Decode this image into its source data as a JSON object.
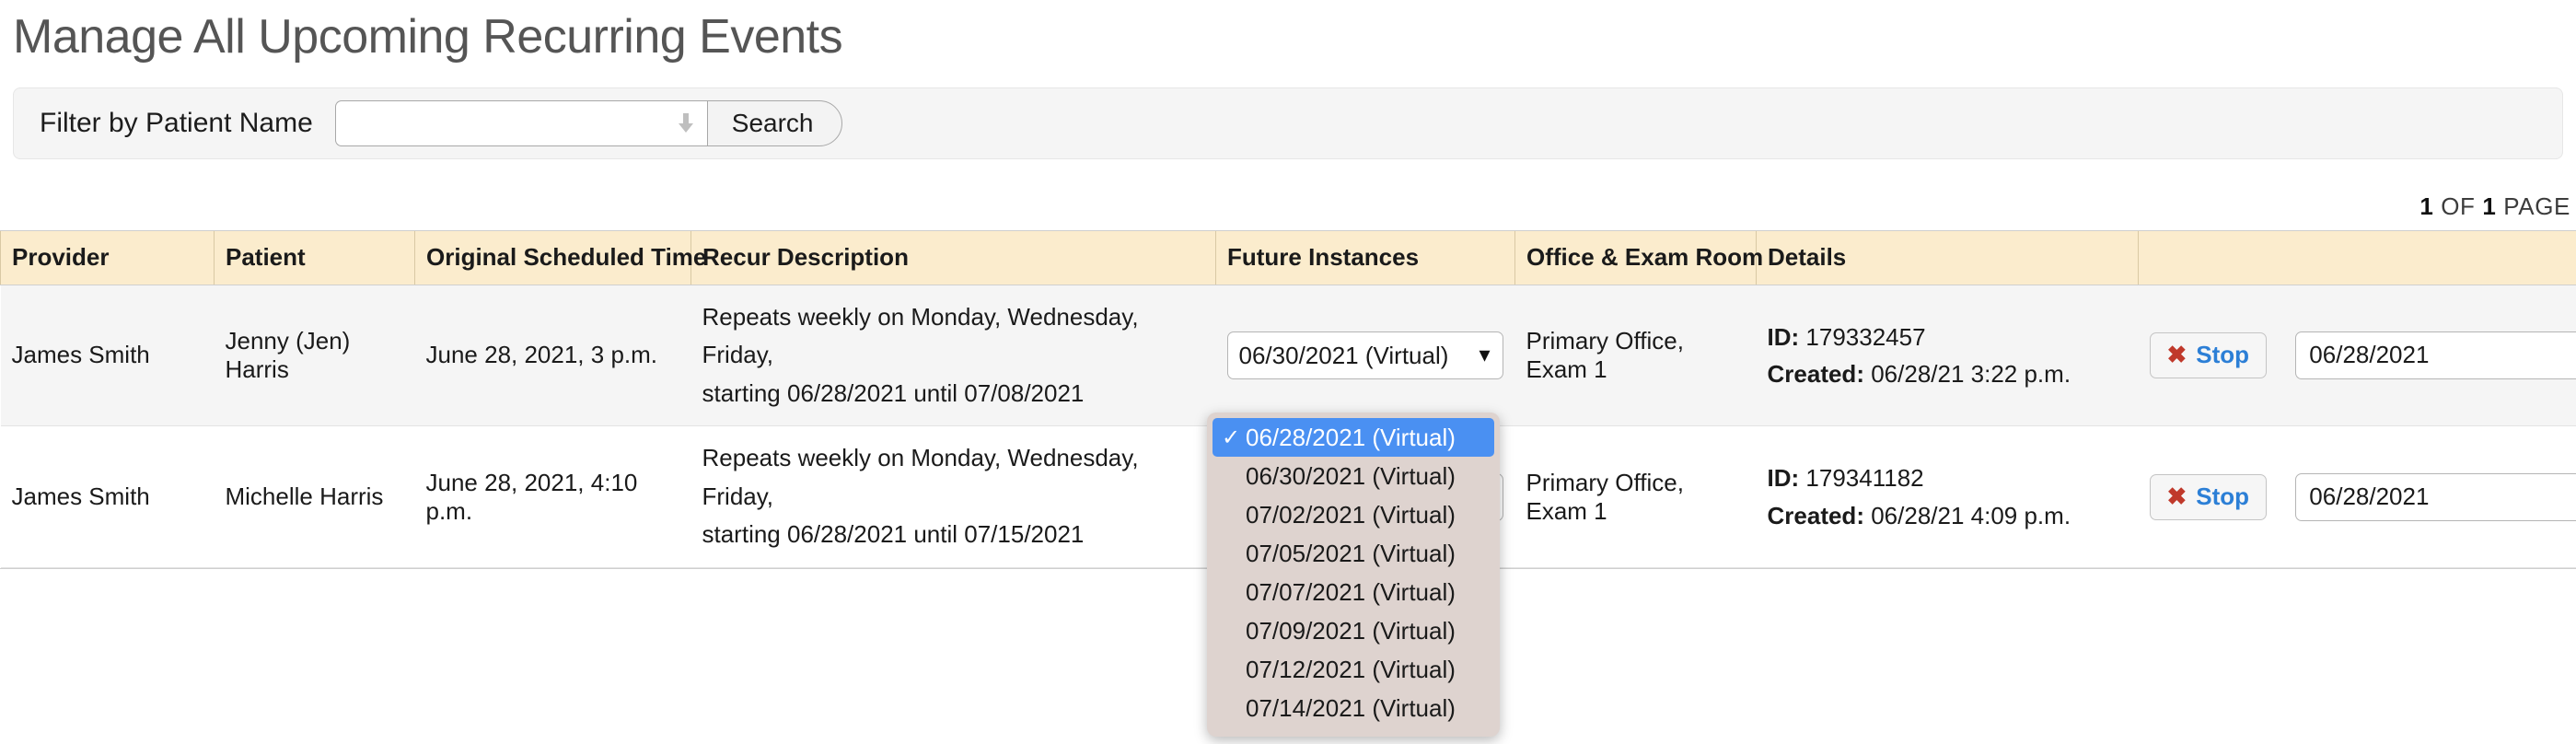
{
  "page_title": "Manage All Upcoming Recurring Events",
  "filter": {
    "label": "Filter by Patient Name",
    "input_value": "",
    "input_placeholder": "",
    "search_label": "Search",
    "combo_arrow_icon": "arrow-down-icon"
  },
  "pagination": {
    "current_page": "1",
    "of_text": "OF",
    "total_pages": "1",
    "pages_word": "PAGE"
  },
  "table": {
    "headers": [
      "Provider",
      "Patient",
      "Original Scheduled Time",
      "Recur Description",
      "Future Instances",
      "Office & Exam Room",
      "Details",
      ""
    ],
    "rows": [
      {
        "provider": "James Smith",
        "patient": "Jenny (Jen) Harris",
        "original_time": "June 28, 2021, 3 p.m.",
        "recur_line1": "Repeats weekly on Monday, Wednesday, Friday,",
        "recur_line2": "starting 06/28/2021 until 07/08/2021",
        "future_selected": "06/30/2021 (Virtual)",
        "office": "Primary Office, Exam 1",
        "details_id_label": "ID:",
        "details_id_value": "179332457",
        "details_created_label": "Created:",
        "details_created_value": "06/28/21 3:22 p.m.",
        "stop_label": "Stop",
        "stop_icon": "close-x-icon",
        "date_value": "06/28/2021"
      },
      {
        "provider": "James Smith",
        "patient": "Michelle Harris",
        "original_time": "June 28, 2021, 4:10 p.m.",
        "recur_line1": "Repeats weekly on Monday, Wednesday, Friday,",
        "recur_line2": "starting 06/28/2021 until 07/15/2021",
        "future_selected": "06/28/2021 (Virtual)",
        "office": "Primary Office, Exam 1",
        "details_id_label": "ID:",
        "details_id_value": "179341182",
        "details_created_label": "Created:",
        "details_created_value": "06/28/21 4:09 p.m.",
        "stop_label": "Stop",
        "stop_icon": "close-x-icon",
        "date_value": "06/28/2021"
      }
    ]
  },
  "open_dropdown": {
    "check_icon": "check-icon",
    "options": [
      {
        "label": "06/28/2021 (Virtual)",
        "selected": true
      },
      {
        "label": "06/30/2021 (Virtual)",
        "selected": false
      },
      {
        "label": "07/02/2021 (Virtual)",
        "selected": false
      },
      {
        "label": "07/05/2021 (Virtual)",
        "selected": false
      },
      {
        "label": "07/07/2021 (Virtual)",
        "selected": false
      },
      {
        "label": "07/09/2021 (Virtual)",
        "selected": false
      },
      {
        "label": "07/12/2021 (Virtual)",
        "selected": false
      },
      {
        "label": "07/14/2021 (Virtual)",
        "selected": false
      }
    ]
  },
  "colors": {
    "header_bg": "#fbeccd",
    "row_alt_bg": "#f5f5f5",
    "accent_link": "#2c7fd6",
    "danger": "#c0392b",
    "dropdown_bg": "#ded3cf",
    "dropdown_selected": "#4a90f2"
  }
}
